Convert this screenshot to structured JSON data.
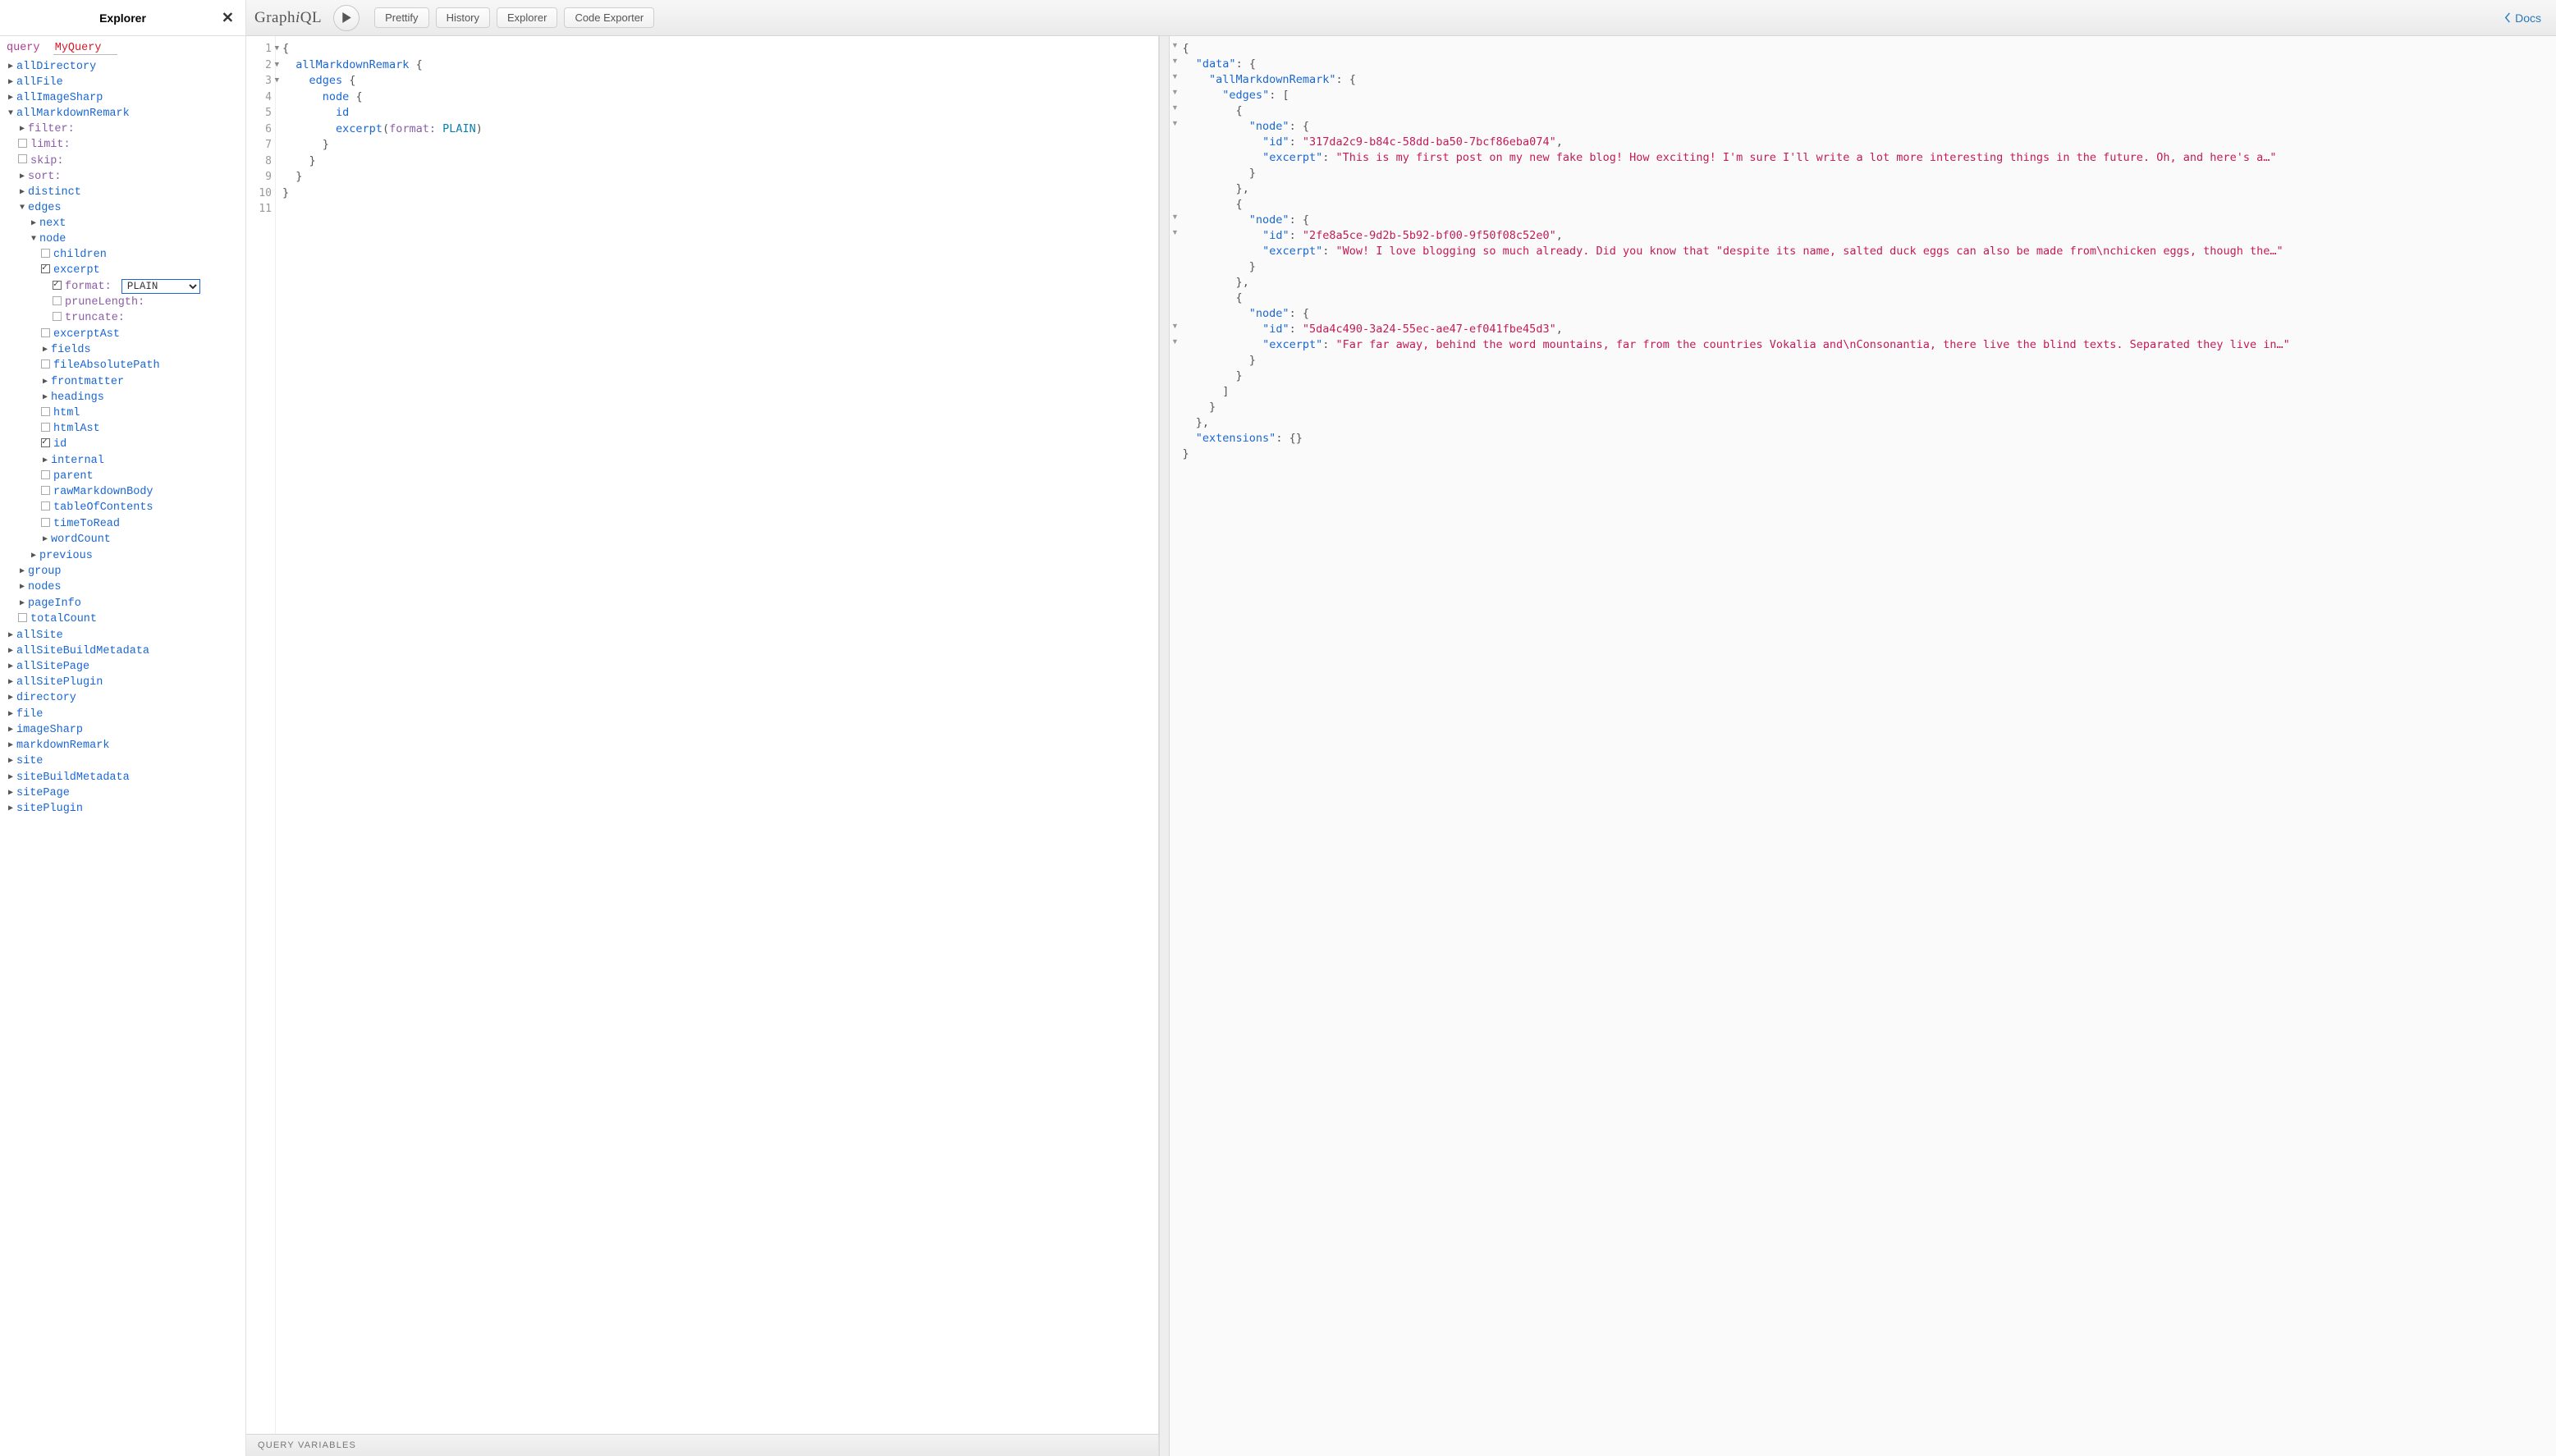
{
  "explorer": {
    "title": "Explorer",
    "query_label": "query",
    "query_name": "MyQuery",
    "root_fields": [
      "allDirectory",
      "allFile",
      "allImageSharp",
      "allMarkdownRemark",
      "allSite",
      "allSiteBuildMetadata",
      "allSitePage",
      "allSitePlugin",
      "directory",
      "file",
      "imageSharp",
      "markdownRemark",
      "site",
      "siteBuildMetadata",
      "sitePage",
      "sitePlugin"
    ],
    "allMarkdownRemark": {
      "args": {
        "filter": "filter:",
        "limit": "limit:",
        "skip": "skip:",
        "sort": "sort:"
      },
      "subfields": {
        "distinct": "distinct",
        "edges": "edges",
        "group": "group",
        "nodes": "nodes",
        "pageInfo": "pageInfo",
        "totalCount": "totalCount"
      },
      "edges": {
        "next": "next",
        "node": "node",
        "previous": "previous"
      },
      "node_fields": {
        "children": "children",
        "excerpt": "excerpt",
        "excerptAst": "excerptAst",
        "fields": "fields",
        "fileAbsolutePath": "fileAbsolutePath",
        "frontmatter": "frontmatter",
        "headings": "headings",
        "html": "html",
        "htmlAst": "htmlAst",
        "id": "id",
        "internal": "internal",
        "parent": "parent",
        "rawMarkdownBody": "rawMarkdownBody",
        "tableOfContents": "tableOfContents",
        "timeToRead": "timeToRead",
        "wordCount": "wordCount"
      },
      "excerpt_args": {
        "format": "format:",
        "format_value": "PLAIN",
        "pruneLength": "pruneLength:",
        "truncate": "truncate:"
      }
    }
  },
  "topbar": {
    "logo_a": "Graph",
    "logo_b": "i",
    "logo_c": "QL",
    "prettify": "Prettify",
    "history": "History",
    "explorer": "Explorer",
    "code_exporter": "Code Exporter",
    "docs": "Docs"
  },
  "editor": {
    "lines": [
      1,
      2,
      3,
      4,
      5,
      6,
      7,
      8,
      9,
      10,
      11
    ],
    "fold_lines": [
      1,
      2,
      3
    ],
    "code_text": "{\n  allMarkdownRemark {\n    edges {\n      node {\n        id\n        excerpt(format: PLAIN)\n      }\n    }\n  }\n}\n",
    "t_allMarkdownRemark": "allMarkdownRemark",
    "t_edges": "edges",
    "t_node": "node",
    "t_id": "id",
    "t_excerpt": "excerpt",
    "t_format": "format",
    "t_plain": "PLAIN",
    "vars_label": "QUERY VARIABLES"
  },
  "result": {
    "data_key": "data",
    "allMarkdownRemark_key": "allMarkdownRemark",
    "edges_key": "edges",
    "node_key": "node",
    "id_key": "id",
    "excerpt_key": "excerpt",
    "extensions_key": "extensions",
    "edges": [
      {
        "id": "317da2c9-b84c-58dd-ba50-7bcf86eba074",
        "excerpt": "This is my first post on my new fake blog! How exciting! I'm sure I'll write a lot more interesting things in the future. Oh, and here's a…"
      },
      {
        "id": "2fe8a5ce-9d2b-5b92-bf00-9f50f08c52e0",
        "excerpt": "Wow! I love blogging so much already. Did you know that \"despite its name, salted duck eggs can also be made from\\nchicken eggs, though the…"
      },
      {
        "id": "5da4c490-3a24-55ec-ae47-ef041fbe45d3",
        "excerpt": "Far far away, behind the word mountains, far from the countries Vokalia and\\nConsonantia, there live the blind texts. Separated they live in…"
      }
    ]
  }
}
